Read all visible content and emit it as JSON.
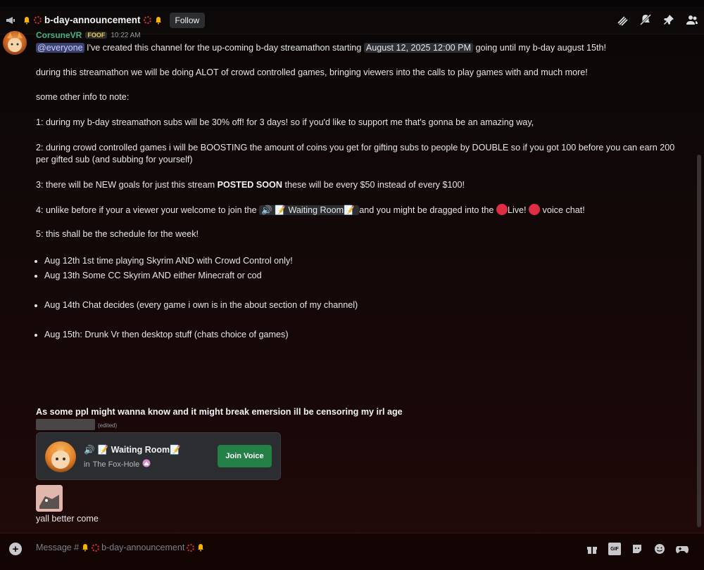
{
  "header": {
    "channel_name": "b-day-announcement",
    "follow_label": "Follow"
  },
  "message": {
    "author": "CorsuneVR",
    "role_tag": "FOOF",
    "time": "10:22 AM",
    "mention": "@everyone",
    "line1_a": "I've created this channel for the up-coming b-day streamathon starting",
    "line1_date": "August 12, 2025 12:00 PM",
    "line1_b": "going until my b-day august 15th!",
    "para2": "during this streamathon we will be doing ALOT of crowd controlled games, bringing viewers into the calls to play games with and much more!",
    "para3": "some other info to note:",
    "para4": "1: during my b-day streamathon subs will be 30% off! for 3 days! so if you'd like to support me that's gonna be an amazing way,",
    "para5": "2: during crowd controlled games i will be BOOSTING the amount of coins you get for gifting subs to people by DOUBLE so if you got 100 before you can earn 200 per gifted sub (and subbing for yourself)",
    "para6_a": "3: there will be NEW goals for just this stream",
    "para6_bold": "POSTED SOON",
    "para6_b": "these will be every $50 instead of every $100!",
    "para7_a": "4: unlike before if your a viewer your welcome to join the",
    "para7_chip": "📝 Waiting Room📝",
    "para7_b": "and you might be dragged into the",
    "para7_live": "Live!",
    "para7_c": "voice chat!",
    "para8": "5: this shall be the schedule for the week!",
    "schedule": [
      "Aug 12th 1st time playing Skyrim AND with Crowd Control only!",
      "Aug 13th Some CC Skyrim AND either Minecraft or cod",
      "Aug 14th Chat decides (every game i own is in the about section of my channel)",
      "Aug 15th: Drunk Vr  then desktop stuff (chats choice of games)"
    ],
    "bold_note": "As some ppl might wanna know and it might break emersion ill be censoring my irl age",
    "edited": "(edited)"
  },
  "voice_card": {
    "room_name": "📝 Waiting Room📝",
    "server_prefix": "in",
    "server_name": "The Fox-Hole",
    "join_label": "Join Voice"
  },
  "followup": {
    "text": "yall better come"
  },
  "composer": {
    "placeholder_prefix": "Message #",
    "channel_name": "b-day-announcement",
    "gif_label": "GIF"
  },
  "colors": {
    "author": "#43b581",
    "join": "#248046",
    "live_dot": "#dd2e44"
  }
}
